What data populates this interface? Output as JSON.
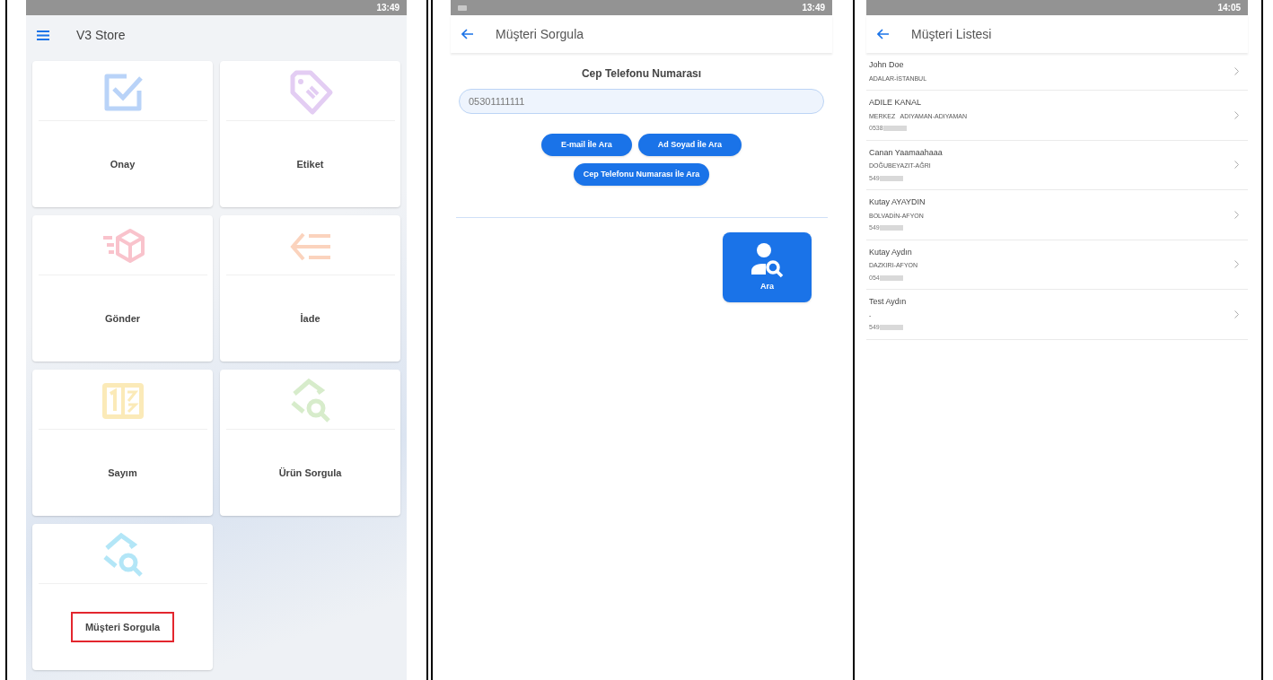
{
  "home_screen": {
    "status_time": "13:49",
    "title": "V3 Store",
    "tiles": [
      {
        "label": "Onay",
        "kind": "check",
        "color": "#b9d3f8",
        "highlighted": false
      },
      {
        "label": "Etiket",
        "kind": "tag",
        "color": "#e3cdf3",
        "highlighted": false
      },
      {
        "label": "Gönder",
        "kind": "send",
        "color": "#f9c3cc",
        "highlighted": false
      },
      {
        "label": "İade",
        "kind": "return",
        "color": "#fbd3bd",
        "highlighted": false
      },
      {
        "label": "Sayım",
        "kind": "count",
        "color": "#fbeab8",
        "highlighted": false
      },
      {
        "label": "Ürün Sorgula",
        "kind": "search",
        "color": "#d7eccb",
        "highlighted": false
      },
      {
        "label": "Müşteri Sorgula",
        "kind": "search",
        "color": "#b3e6f7",
        "highlighted": true
      }
    ]
  },
  "search_screen": {
    "status_time": "13:49",
    "title": "Müşteri Sorgula",
    "field_label": "Cep Telefonu Numarası",
    "field_value": "05301111111",
    "buttons": [
      "E-mail İle Ara",
      "Ad Soyad İle Ara",
      "Cep Telefonu Numarası İle Ara"
    ],
    "action_button": "Ara"
  },
  "list_screen": {
    "status_time": "14:05",
    "title": "Müşteri Listesi",
    "customers": [
      {
        "name": "John Doe",
        "address": "ADALAR-İSTANBUL"
      },
      {
        "name": "ADILE KANAL",
        "address": "MERKEZ   ADIYAMAN-ADIYAMAN",
        "phone": "0538"
      },
      {
        "name": "Canan Yaamaahaaa",
        "address": "DOĞUBEYAZIT-AĞRI",
        "phone": "549"
      },
      {
        "name": "Kutay AYAYDIN",
        "address": "BOLVADİN-AFYON",
        "phone": "549"
      },
      {
        "name": "Kutay Aydın",
        "address": "DAZKIRI-AFYON",
        "phone": "054"
      },
      {
        "name": "Test Aydın",
        "address": "-",
        "phone": "549"
      }
    ]
  }
}
